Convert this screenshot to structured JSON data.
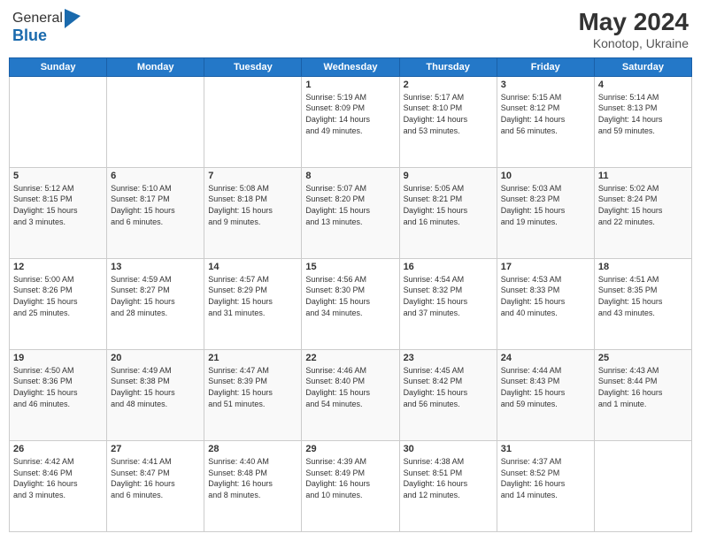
{
  "header": {
    "logo_general": "General",
    "logo_blue": "Blue",
    "month_year": "May 2024",
    "location": "Konotop, Ukraine"
  },
  "days_of_week": [
    "Sunday",
    "Monday",
    "Tuesday",
    "Wednesday",
    "Thursday",
    "Friday",
    "Saturday"
  ],
  "weeks": [
    [
      {
        "day": "",
        "info": ""
      },
      {
        "day": "",
        "info": ""
      },
      {
        "day": "",
        "info": ""
      },
      {
        "day": "1",
        "info": "Sunrise: 5:19 AM\nSunset: 8:09 PM\nDaylight: 14 hours\nand 49 minutes."
      },
      {
        "day": "2",
        "info": "Sunrise: 5:17 AM\nSunset: 8:10 PM\nDaylight: 14 hours\nand 53 minutes."
      },
      {
        "day": "3",
        "info": "Sunrise: 5:15 AM\nSunset: 8:12 PM\nDaylight: 14 hours\nand 56 minutes."
      },
      {
        "day": "4",
        "info": "Sunrise: 5:14 AM\nSunset: 8:13 PM\nDaylight: 14 hours\nand 59 minutes."
      }
    ],
    [
      {
        "day": "5",
        "info": "Sunrise: 5:12 AM\nSunset: 8:15 PM\nDaylight: 15 hours\nand 3 minutes."
      },
      {
        "day": "6",
        "info": "Sunrise: 5:10 AM\nSunset: 8:17 PM\nDaylight: 15 hours\nand 6 minutes."
      },
      {
        "day": "7",
        "info": "Sunrise: 5:08 AM\nSunset: 8:18 PM\nDaylight: 15 hours\nand 9 minutes."
      },
      {
        "day": "8",
        "info": "Sunrise: 5:07 AM\nSunset: 8:20 PM\nDaylight: 15 hours\nand 13 minutes."
      },
      {
        "day": "9",
        "info": "Sunrise: 5:05 AM\nSunset: 8:21 PM\nDaylight: 15 hours\nand 16 minutes."
      },
      {
        "day": "10",
        "info": "Sunrise: 5:03 AM\nSunset: 8:23 PM\nDaylight: 15 hours\nand 19 minutes."
      },
      {
        "day": "11",
        "info": "Sunrise: 5:02 AM\nSunset: 8:24 PM\nDaylight: 15 hours\nand 22 minutes."
      }
    ],
    [
      {
        "day": "12",
        "info": "Sunrise: 5:00 AM\nSunset: 8:26 PM\nDaylight: 15 hours\nand 25 minutes."
      },
      {
        "day": "13",
        "info": "Sunrise: 4:59 AM\nSunset: 8:27 PM\nDaylight: 15 hours\nand 28 minutes."
      },
      {
        "day": "14",
        "info": "Sunrise: 4:57 AM\nSunset: 8:29 PM\nDaylight: 15 hours\nand 31 minutes."
      },
      {
        "day": "15",
        "info": "Sunrise: 4:56 AM\nSunset: 8:30 PM\nDaylight: 15 hours\nand 34 minutes."
      },
      {
        "day": "16",
        "info": "Sunrise: 4:54 AM\nSunset: 8:32 PM\nDaylight: 15 hours\nand 37 minutes."
      },
      {
        "day": "17",
        "info": "Sunrise: 4:53 AM\nSunset: 8:33 PM\nDaylight: 15 hours\nand 40 minutes."
      },
      {
        "day": "18",
        "info": "Sunrise: 4:51 AM\nSunset: 8:35 PM\nDaylight: 15 hours\nand 43 minutes."
      }
    ],
    [
      {
        "day": "19",
        "info": "Sunrise: 4:50 AM\nSunset: 8:36 PM\nDaylight: 15 hours\nand 46 minutes."
      },
      {
        "day": "20",
        "info": "Sunrise: 4:49 AM\nSunset: 8:38 PM\nDaylight: 15 hours\nand 48 minutes."
      },
      {
        "day": "21",
        "info": "Sunrise: 4:47 AM\nSunset: 8:39 PM\nDaylight: 15 hours\nand 51 minutes."
      },
      {
        "day": "22",
        "info": "Sunrise: 4:46 AM\nSunset: 8:40 PM\nDaylight: 15 hours\nand 54 minutes."
      },
      {
        "day": "23",
        "info": "Sunrise: 4:45 AM\nSunset: 8:42 PM\nDaylight: 15 hours\nand 56 minutes."
      },
      {
        "day": "24",
        "info": "Sunrise: 4:44 AM\nSunset: 8:43 PM\nDaylight: 15 hours\nand 59 minutes."
      },
      {
        "day": "25",
        "info": "Sunrise: 4:43 AM\nSunset: 8:44 PM\nDaylight: 16 hours\nand 1 minute."
      }
    ],
    [
      {
        "day": "26",
        "info": "Sunrise: 4:42 AM\nSunset: 8:46 PM\nDaylight: 16 hours\nand 3 minutes."
      },
      {
        "day": "27",
        "info": "Sunrise: 4:41 AM\nSunset: 8:47 PM\nDaylight: 16 hours\nand 6 minutes."
      },
      {
        "day": "28",
        "info": "Sunrise: 4:40 AM\nSunset: 8:48 PM\nDaylight: 16 hours\nand 8 minutes."
      },
      {
        "day": "29",
        "info": "Sunrise: 4:39 AM\nSunset: 8:49 PM\nDaylight: 16 hours\nand 10 minutes."
      },
      {
        "day": "30",
        "info": "Sunrise: 4:38 AM\nSunset: 8:51 PM\nDaylight: 16 hours\nand 12 minutes."
      },
      {
        "day": "31",
        "info": "Sunrise: 4:37 AM\nSunset: 8:52 PM\nDaylight: 16 hours\nand 14 minutes."
      },
      {
        "day": "",
        "info": ""
      }
    ]
  ]
}
